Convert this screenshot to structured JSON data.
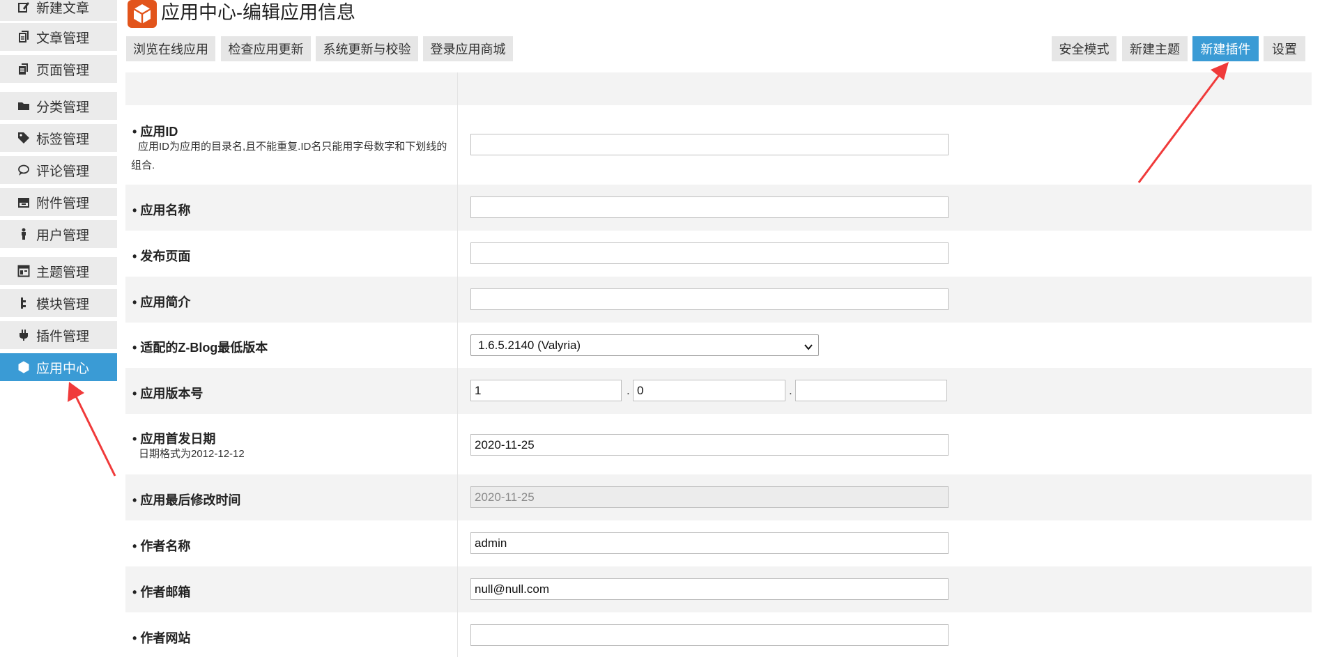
{
  "sidebar": {
    "items": [
      {
        "label": "新建文章",
        "icon": "edit-icon"
      },
      {
        "label": "文章管理",
        "icon": "documents-icon"
      },
      {
        "label": "页面管理",
        "icon": "pages-icon"
      },
      {
        "label": "分类管理",
        "icon": "folder-icon"
      },
      {
        "label": "标签管理",
        "icon": "tag-icon"
      },
      {
        "label": "评论管理",
        "icon": "comment-icon"
      },
      {
        "label": "附件管理",
        "icon": "attachment-icon"
      },
      {
        "label": "用户管理",
        "icon": "user-icon"
      },
      {
        "label": "主题管理",
        "icon": "theme-icon"
      },
      {
        "label": "模块管理",
        "icon": "module-icon"
      },
      {
        "label": "插件管理",
        "icon": "plugin-icon"
      },
      {
        "label": "应用中心",
        "icon": "app-center-icon",
        "active": true
      }
    ]
  },
  "header": {
    "title": "应用中心-编辑应用信息",
    "left_buttons": [
      "浏览在线应用",
      "检查应用更新",
      "系统更新与校验",
      "登录应用商城"
    ],
    "right_buttons": [
      "安全模式",
      "新建主题",
      "新建插件",
      "设置"
    ],
    "accent": "#3a9bd5",
    "logo_color": "#e2541b"
  },
  "form": {
    "app_id": {
      "label": "应用ID",
      "hint": "应用ID为应用的目录名,且不能重复.ID名只能用字母数字和下划线的组合.",
      "value": ""
    },
    "app_name": {
      "label": "应用名称",
      "value": ""
    },
    "publish_page": {
      "label": "发布页面",
      "value": ""
    },
    "app_intro": {
      "label": "应用简介",
      "value": ""
    },
    "min_version": {
      "label": "适配的Z-Blog最低版本",
      "value": "1.6.5.2140 (Valyria)"
    },
    "version": {
      "label": "应用版本号",
      "major": "1",
      "minor": "0",
      "patch": "",
      "separator": "."
    },
    "release_date": {
      "label": "应用首发日期",
      "hint": "日期格式为2012-12-12",
      "value": "2020-11-25"
    },
    "modified_date": {
      "label": "应用最后修改时间",
      "value": "2020-11-25"
    },
    "author_name": {
      "label": "作者名称",
      "value": "admin"
    },
    "author_email": {
      "label": "作者邮箱",
      "value": "null@null.com"
    },
    "author_site": {
      "label": "作者网站",
      "value": ""
    }
  },
  "bullet": "•",
  "annotation_color": "#f03a3a"
}
